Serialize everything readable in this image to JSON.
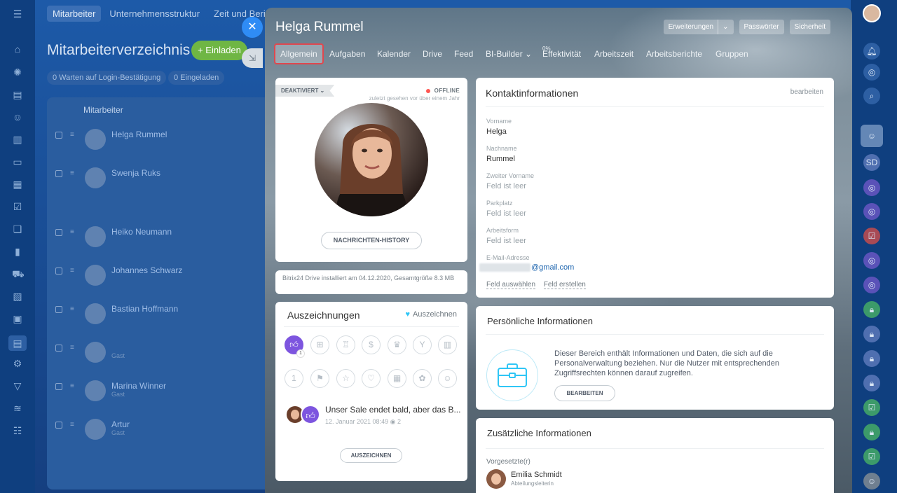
{
  "bg": {
    "tabs": [
      "Mitarbeiter",
      "Unternehmensstruktur",
      "Zeit und Berichte"
    ],
    "title": "Mitarbeiterverzeichnis",
    "invite_label": "+ Einladen",
    "filters": [
      "0  Warten auf Login-Bestätigung",
      "0  Eingeladen"
    ],
    "table_header": "Mitarbeiter",
    "rows": [
      {
        "name": "Helga Rummel",
        "sub": ""
      },
      {
        "name": "Swenja Ruks",
        "sub": ""
      },
      {
        "name": "Heiko Neumann",
        "sub": ""
      },
      {
        "name": "Johannes Schwarz",
        "sub": ""
      },
      {
        "name": "Bastian Hoffmann",
        "sub": ""
      },
      {
        "name": "",
        "sub": "Gast"
      },
      {
        "name": "Marina Winner",
        "sub": "Gast"
      },
      {
        "name": "Artur",
        "sub": "Gast"
      }
    ]
  },
  "slider": {
    "user_name": "Helga Rummel",
    "header_buttons": {
      "extensions": "Erweiterungen",
      "passwords": "Passwörter",
      "security": "Sicherheit"
    },
    "tabs": [
      {
        "label": "Allgemein",
        "active": true
      },
      {
        "label": "Aufgaben"
      },
      {
        "label": "Kalender"
      },
      {
        "label": "Drive"
      },
      {
        "label": "Feed"
      },
      {
        "label": "BI-Builder ⌄"
      },
      {
        "label": "Effektivität",
        "badge": "0%"
      },
      {
        "label": "Arbeitszeit"
      },
      {
        "label": "Arbeitsberichte"
      },
      {
        "label": "Gruppen"
      }
    ]
  },
  "profile": {
    "status_ribbon": "DEAKTIVIERT ⌄",
    "online_state": "OFFLINE",
    "last_seen": "zuletzt gesehen vor über einem Jahr",
    "history_button": "NACHRICHTEN-HISTORY",
    "status_color": "#ff5752"
  },
  "drive_info": "Bitrix24 Drive installiert am 04.12.2020, Gesamtgröße 8.3 MB",
  "awards": {
    "title": "Auszeichnungen",
    "give_label": "Auszeichnen",
    "like_count": "1",
    "feed_text": "Unser Sale endet bald, aber das B...",
    "feed_date": "12. Januar 2021 08:49",
    "feed_views": "2",
    "button": "AUSZEICHNEN",
    "accent": "#7d55df"
  },
  "contact": {
    "title": "Kontaktinformationen",
    "edit_label": "bearbeiten",
    "fields": [
      {
        "label": "Vorname",
        "value": "Helga"
      },
      {
        "label": "Nachname",
        "value": "Rummel"
      },
      {
        "label": "Zweiter Vorname",
        "value": "Feld ist leer"
      },
      {
        "label": "Parkplatz",
        "value": "Feld ist leer"
      },
      {
        "label": "Arbeitsform",
        "value": "Feld ist leer"
      },
      {
        "label": "E-Mail-Adresse",
        "value": "@gmail.com"
      }
    ],
    "select_field": "Feld auswählen",
    "create_field": "Feld erstellen"
  },
  "personal": {
    "title": "Persönliche Informationen",
    "text": "Dieser Bereich enthält Informationen und Daten, die sich auf die Personalverwaltung beziehen. Nur die Nutzer mit entsprechenden Zugriffsrechten können darauf zugreifen.",
    "button": "BEARBEITEN"
  },
  "extra": {
    "title": "Zusätzliche Informationen",
    "supervisor_label": "Vorgesetzte(r)",
    "supervisor_name": "Emilia Schmidt",
    "supervisor_role": "Abteilungsleiterin"
  }
}
